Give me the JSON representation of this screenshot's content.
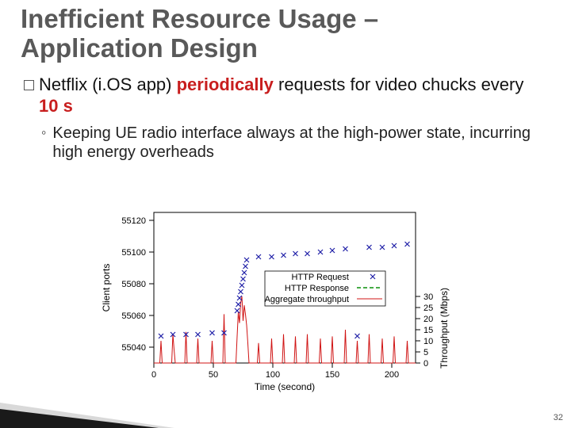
{
  "title_line1": "Inefficient Resource Usage –",
  "title_line2": "Application Design",
  "bullet1_a": "Netflix (i.OS app) ",
  "bullet1_b": "periodically",
  "bullet1_c": " requests for video chucks every ",
  "bullet1_d": "10 s",
  "bullet2": "Keeping UE radio interface always at the high-power state, incurring high energy overheads",
  "chart": {
    "xlabel": "Time (second)",
    "ylabel_left": "Client ports",
    "ylabel_right": "Throughput (Mbps)",
    "legend": {
      "a": "HTTP Request",
      "b": "HTTP Response",
      "c": "Aggregate throughput"
    }
  },
  "ticks": {
    "x": [
      "0",
      "50",
      "100",
      "150",
      "200"
    ],
    "yL": [
      "55040",
      "55060",
      "55080",
      "55100",
      "55120"
    ],
    "yR": [
      "0",
      "5",
      "10",
      "15",
      "20",
      "25",
      "30"
    ]
  },
  "page_number": "32",
  "chart_data": {
    "type": "scatter+line",
    "xlabel": "Time (second)",
    "ylabel_left": "Client ports",
    "ylabel_right": "Throughput (Mbps)",
    "xlim": [
      0,
      220
    ],
    "ylim_left": [
      55030,
      55125
    ],
    "ylim_right": [
      0,
      32
    ],
    "series": [
      {
        "name": "HTTP Request",
        "axis": "left",
        "type": "scatter",
        "points": [
          [
            6,
            55047
          ],
          [
            16,
            55048
          ],
          [
            27,
            55048
          ],
          [
            37,
            55048
          ],
          [
            49,
            55049
          ],
          [
            59,
            55049
          ],
          [
            70,
            55063
          ],
          [
            71,
            55067
          ],
          [
            72,
            55071
          ],
          [
            73,
            55075
          ],
          [
            74,
            55079
          ],
          [
            75,
            55083
          ],
          [
            76,
            55087
          ],
          [
            77,
            55091
          ],
          [
            78,
            55095
          ],
          [
            88,
            55097
          ],
          [
            99,
            55097
          ],
          [
            109,
            55098
          ],
          [
            119,
            55099
          ],
          [
            129,
            55099
          ],
          [
            140,
            55100
          ],
          [
            150,
            55101
          ],
          [
            161,
            55102
          ],
          [
            171,
            55047
          ],
          [
            181,
            55103
          ],
          [
            192,
            55103
          ],
          [
            202,
            55104
          ],
          [
            213,
            55105
          ]
        ]
      },
      {
        "name": "HTTP Response",
        "axis": "left",
        "type": "line",
        "note": "dashed, overlaps request markers visually",
        "points": []
      },
      {
        "name": "Aggregate throughput",
        "axis": "right",
        "type": "line",
        "points": [
          [
            0,
            0
          ],
          [
            5,
            0
          ],
          [
            6,
            10
          ],
          [
            7,
            0
          ],
          [
            15,
            0
          ],
          [
            16,
            13
          ],
          [
            17,
            6
          ],
          [
            18,
            0
          ],
          [
            26,
            0
          ],
          [
            27,
            14
          ],
          [
            28,
            0
          ],
          [
            36,
            0
          ],
          [
            37,
            11
          ],
          [
            38,
            0
          ],
          [
            48,
            0
          ],
          [
            49,
            10
          ],
          [
            50,
            0
          ],
          [
            58,
            0
          ],
          [
            59,
            22
          ],
          [
            60,
            0
          ],
          [
            69,
            0
          ],
          [
            70,
            12
          ],
          [
            71,
            23
          ],
          [
            72,
            18
          ],
          [
            73,
            27
          ],
          [
            74,
            30
          ],
          [
            75,
            19
          ],
          [
            76,
            26
          ],
          [
            77,
            22
          ],
          [
            78,
            17
          ],
          [
            79,
            9
          ],
          [
            80,
            0
          ],
          [
            87,
            0
          ],
          [
            88,
            9
          ],
          [
            89,
            0
          ],
          [
            98,
            0
          ],
          [
            99,
            11
          ],
          [
            100,
            0
          ],
          [
            108,
            0
          ],
          [
            109,
            13
          ],
          [
            110,
            0
          ],
          [
            118,
            0
          ],
          [
            119,
            12
          ],
          [
            120,
            0
          ],
          [
            128,
            0
          ],
          [
            129,
            13
          ],
          [
            130,
            0
          ],
          [
            139,
            0
          ],
          [
            140,
            11
          ],
          [
            141,
            0
          ],
          [
            149,
            0
          ],
          [
            150,
            12
          ],
          [
            151,
            0
          ],
          [
            160,
            0
          ],
          [
            161,
            15
          ],
          [
            162,
            0
          ],
          [
            170,
            0
          ],
          [
            171,
            10
          ],
          [
            172,
            0
          ],
          [
            180,
            0
          ],
          [
            181,
            13
          ],
          [
            182,
            0
          ],
          [
            191,
            0
          ],
          [
            192,
            11
          ],
          [
            193,
            0
          ],
          [
            201,
            0
          ],
          [
            202,
            12
          ],
          [
            203,
            0
          ],
          [
            212,
            0
          ],
          [
            213,
            10
          ],
          [
            214,
            0
          ],
          [
            220,
            0
          ]
        ]
      }
    ]
  }
}
